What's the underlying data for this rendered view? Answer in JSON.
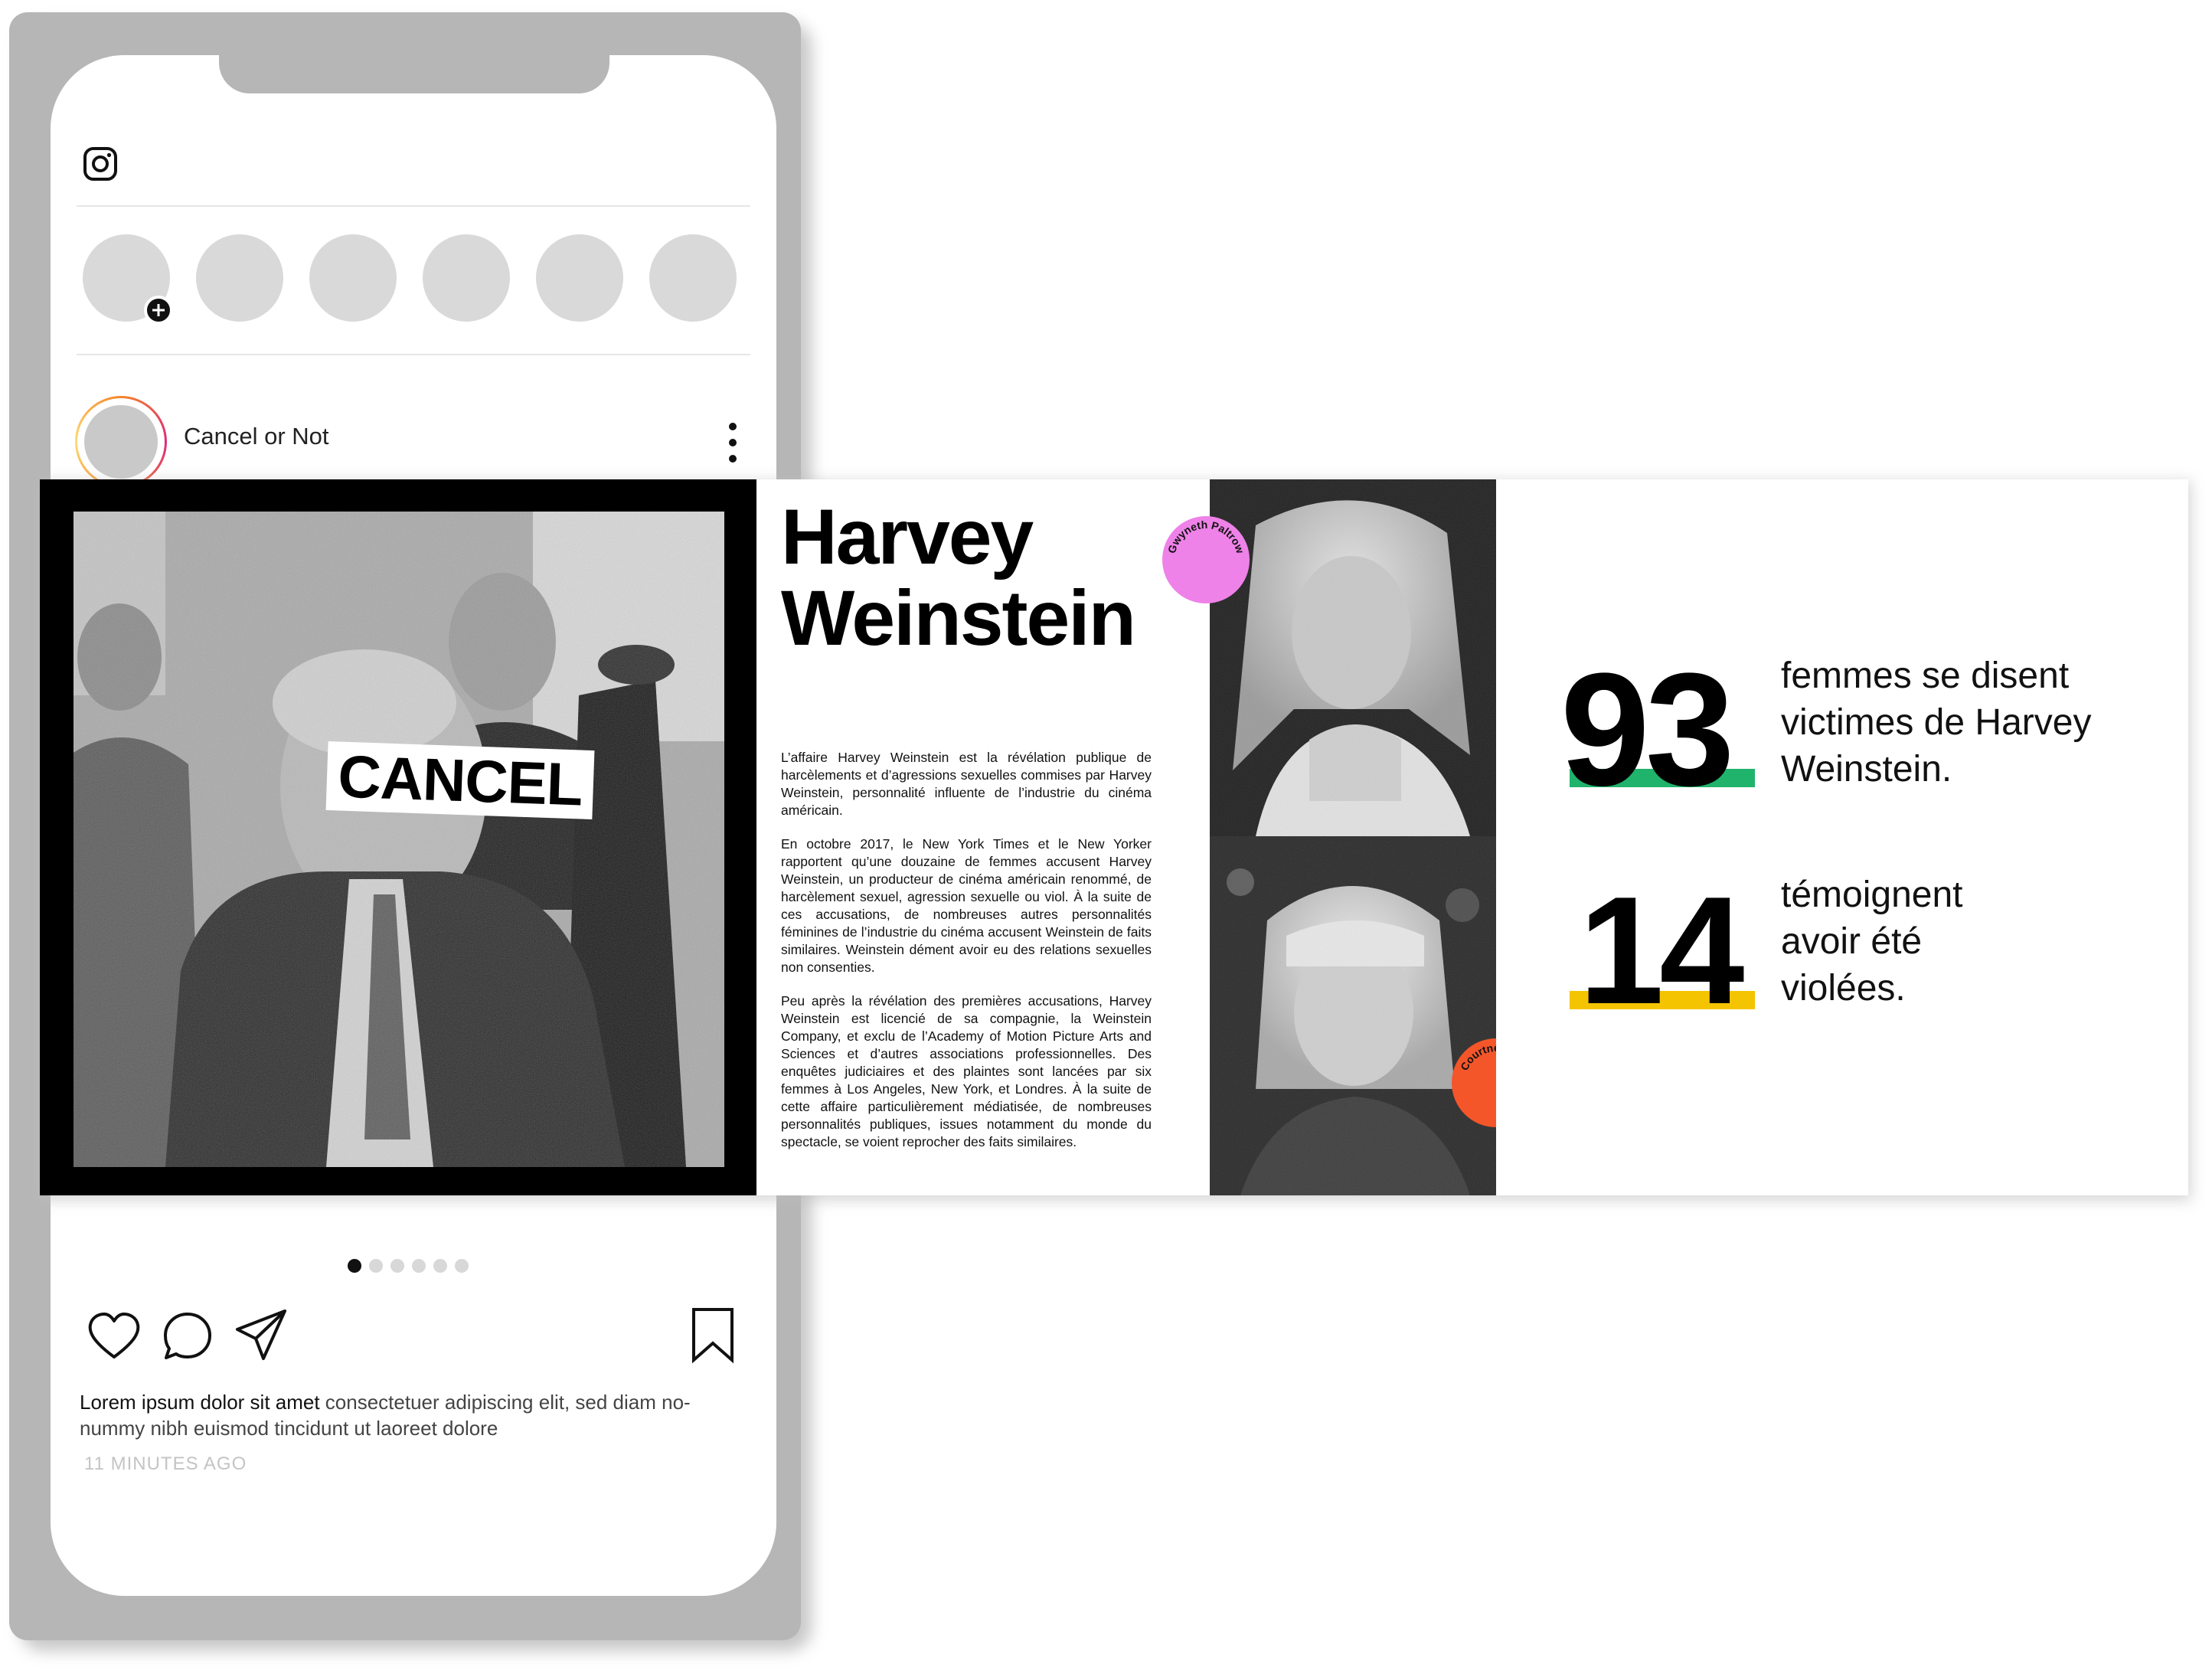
{
  "phone": {
    "account_name": "Cancel or Not",
    "caption_bold": "Lorem ipsum dolor sit amet",
    "caption_rest": " consectetuer adipiscing elit, sed diam no- nummy nibh euismod tincidunt ut laoreet dolore",
    "timestamp": "11 MINUTES AGO",
    "carousel_pages": 6,
    "carousel_active_index": 0
  },
  "slide_cover": {
    "label": "CANCEL"
  },
  "slide_text": {
    "title_line1": "Harvey",
    "title_line2": "Weinstein",
    "paragraphs": [
      "L’affaire Harvey Weinstein est la révélation publique de harcèlements et d’agressions sexuelles commises par Harvey Weinstein, personnalité influente de l’industrie du cinéma américain.",
      "En octobre 2017, le New York Times et le New Yorker rapportent qu’une douzaine de femmes accusent Harvey Weinstein, un producteur de cinéma américain renommé, de harcèlement sexuel, agression sexuelle ou viol. À la suite de ces accusations, de nombreuses autres personnalités féminines de l’industrie du cinéma accusent Weinstein de faits similaires. Weinstein dément avoir eu des relations sexuelles non consenties.",
      "Peu après la révélation des premières accusations, Harvey Weinstein est licencié de sa compagnie, la Weinstein Company, et exclu de l’Academy of Motion Picture Arts and Sciences et d’autres associations professionnelles. Des enquêtes judiciaires et des plaintes sont lancées par six femmes à Los Angeles, New York, et Londres. À la suite de cette affaire particulièrement médiatisée, de nombreuses personnalités publiques, issues notamment du monde du spectacle, se voient reprocher des faits similaires."
    ]
  },
  "slide_photos": {
    "badge_top": "Gwyneth Paltrow",
    "badge_bottom": "Courtney Love",
    "badge_top_color": "#ee82e8",
    "badge_bottom_color": "#f4562a"
  },
  "slide_stats": {
    "stats": [
      {
        "number": "93",
        "text_lines": [
          "femmes se disent",
          "victimes de Harvey",
          "Weinstein."
        ],
        "bar_color": "#1fb36b"
      },
      {
        "number": "14",
        "text_lines": [
          "témoignent",
          "avoir été",
          "violées."
        ],
        "bar_color": "#f5c400"
      }
    ]
  }
}
